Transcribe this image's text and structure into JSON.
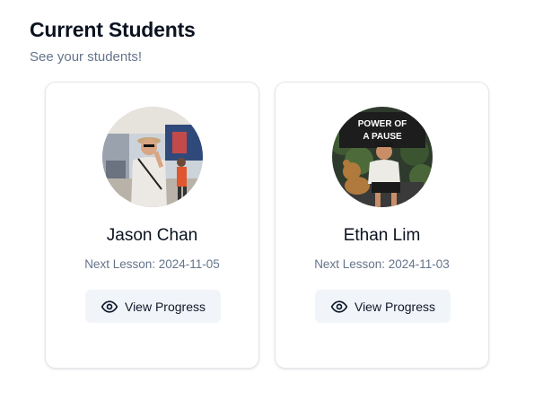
{
  "header": {
    "title": "Current Students",
    "subtitle": "See your students!"
  },
  "students": [
    {
      "name": "Jason Chan",
      "next_lesson": "Next Lesson: 2024-11-05",
      "button_label": "View Progress",
      "button_icon": "eye-icon"
    },
    {
      "name": "Ethan Lim",
      "next_lesson": "Next Lesson: 2024-11-03",
      "button_label": "View Progress",
      "button_icon": "eye-icon"
    }
  ],
  "avatars": {
    "card1_banner_text": "",
    "card2_banner_text": "POWER OF A PAUSE"
  },
  "colors": {
    "button_bg": "#f1f5f9",
    "muted_text": "#64748b",
    "card_border": "#e5e7eb"
  }
}
